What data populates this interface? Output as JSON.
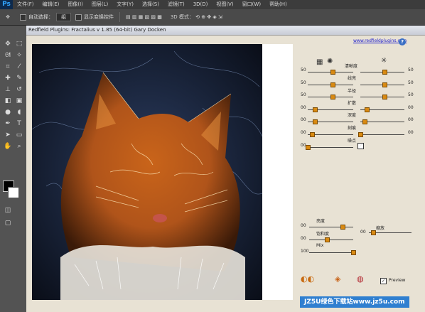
{
  "menubar": {
    "logo": "Ps",
    "items": [
      "文件(F)",
      "编辑(E)",
      "图像(I)",
      "图层(L)",
      "文字(Y)",
      "选择(S)",
      "滤镜(T)",
      "3D(D)",
      "视图(V)",
      "窗口(W)",
      "帮助(H)"
    ]
  },
  "options": {
    "auto_select_label": "自动选择：",
    "auto_select_value": "组",
    "show_transform_label": "显示变换控件",
    "mode_label": "3D 模式："
  },
  "dialog": {
    "title": "Redfield Plugins: Fractalius v 1.85 (64-bit)   Gary Docken",
    "link": "www.redfieldplugins.com",
    "help": "?",
    "sliders": [
      {
        "label": "清晰度",
        "left_value": "50",
        "right_value": "50"
      },
      {
        "label": "线亮",
        "left_value": "50",
        "right_value": "50"
      },
      {
        "label": "半径",
        "left_value": "50",
        "right_value": "50"
      },
      {
        "label": "扩散",
        "left_value": "00",
        "right_value": "00"
      },
      {
        "label": "深度",
        "left_value": "00",
        "right_value": "00"
      },
      {
        "label": "刻痕",
        "left_value": "00",
        "right_value": "00"
      },
      {
        "label": "噪点",
        "left_value": "00",
        "right_value": ""
      }
    ],
    "slider_levels_left": [
      0.55,
      0.55,
      0.55,
      0.15,
      0.15,
      0.1,
      0.0
    ],
    "slider_levels_right": [
      0.55,
      0.55,
      0.55,
      0.15,
      0.1,
      0.0,
      0
    ],
    "bottom_sliders": [
      {
        "label": "亮度",
        "value": "00"
      },
      {
        "label": "饱和度",
        "value": "00"
      },
      {
        "label": "Mix",
        "value": "100"
      }
    ],
    "bottom_levels": [
      0.75,
      0.4,
      1.0
    ],
    "scale_slider": {
      "label": "缩放",
      "value": "00"
    },
    "scale_level": 0.1,
    "preview_label": "Preview",
    "preview_checked": "✓"
  },
  "watermark": "JZ5U绿色下载站www.jz5u.com",
  "colors": {
    "accent": "#d98a12",
    "link": "#2222cc"
  }
}
